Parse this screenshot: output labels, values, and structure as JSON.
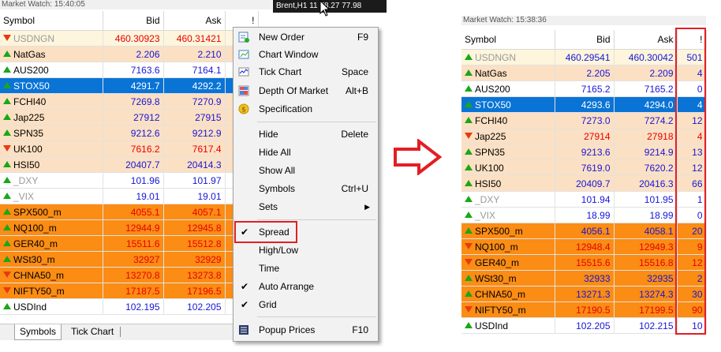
{
  "left": {
    "title": "Market Watch: 15:40:05",
    "columns": [
      "Symbol",
      "Bid",
      "Ask",
      "!"
    ],
    "rows": [
      {
        "symbol": "USDNGN",
        "bid": "460.30923",
        "ask": "460.31421",
        "bg": "yellow",
        "tc": "red",
        "dir": "down",
        "gray": true
      },
      {
        "symbol": "NatGas",
        "bid": "2.206",
        "ask": "2.210",
        "bg": "peach",
        "tc": "blue",
        "dir": "up",
        "gray": false
      },
      {
        "symbol": "AUS200",
        "bid": "7163.6",
        "ask": "7164.1",
        "bg": "white",
        "tc": "blue",
        "dir": "up",
        "gray": false
      },
      {
        "symbol": "STOX50",
        "bid": "4291.7",
        "ask": "4292.2",
        "bg": "blue",
        "tc": "blue",
        "dir": "up",
        "gray": false
      },
      {
        "symbol": "FCHI40",
        "bid": "7269.8",
        "ask": "7270.9",
        "bg": "peach",
        "tc": "blue",
        "dir": "up",
        "gray": false
      },
      {
        "symbol": "Jap225",
        "bid": "27912",
        "ask": "27915",
        "bg": "peach",
        "tc": "blue",
        "dir": "up",
        "gray": false
      },
      {
        "symbol": "SPN35",
        "bid": "9212.6",
        "ask": "9212.9",
        "bg": "peach",
        "tc": "blue",
        "dir": "up",
        "gray": false
      },
      {
        "symbol": "UK100",
        "bid": "7616.2",
        "ask": "7617.4",
        "bg": "peach",
        "tc": "red",
        "dir": "down",
        "gray": false
      },
      {
        "symbol": "HSI50",
        "bid": "20407.7",
        "ask": "20414.3",
        "bg": "peach",
        "tc": "blue",
        "dir": "up",
        "gray": false
      },
      {
        "symbol": "_DXY",
        "bid": "101.96",
        "ask": "101.97",
        "bg": "white",
        "tc": "blue",
        "dir": "up",
        "gray": true
      },
      {
        "symbol": "_VIX",
        "bid": "19.01",
        "ask": "19.01",
        "bg": "white",
        "tc": "blue",
        "dir": "up",
        "gray": true
      },
      {
        "symbol": "SPX500_m",
        "bid": "4055.1",
        "ask": "4057.1",
        "bg": "orange",
        "tc": "red",
        "dir": "up",
        "gray": false
      },
      {
        "symbol": "NQ100_m",
        "bid": "12944.9",
        "ask": "12945.8",
        "bg": "orange",
        "tc": "red",
        "dir": "up",
        "gray": false
      },
      {
        "symbol": "GER40_m",
        "bid": "15511.6",
        "ask": "15512.8",
        "bg": "orange",
        "tc": "red",
        "dir": "up",
        "gray": false
      },
      {
        "symbol": "WSt30_m",
        "bid": "32927",
        "ask": "32929",
        "bg": "orange",
        "tc": "red",
        "dir": "up",
        "gray": false
      },
      {
        "symbol": "CHNA50_m",
        "bid": "13270.8",
        "ask": "13273.8",
        "bg": "orange",
        "tc": "red",
        "dir": "down",
        "gray": false
      },
      {
        "symbol": "NIFTY50_m",
        "bid": "17187.5",
        "ask": "17196.5",
        "bg": "orange",
        "tc": "red",
        "dir": "down",
        "gray": false
      },
      {
        "symbol": "USDInd",
        "bid": "102.195",
        "ask": "102.205",
        "bg": "white",
        "tc": "blue",
        "dir": "up",
        "gray": false
      }
    ],
    "tabs": [
      "Symbols",
      "Tick Chart"
    ]
  },
  "chart_window_title": "Brent,H1  11 78.27 77.98",
  "menu": {
    "items": [
      {
        "label": "New Order",
        "shortcut": "F9",
        "icon": "new-order-icon"
      },
      {
        "label": "Chart Window",
        "shortcut": "",
        "icon": "chart-window-icon"
      },
      {
        "label": "Tick Chart",
        "shortcut": "Space",
        "icon": "tick-chart-icon"
      },
      {
        "label": "Depth Of Market",
        "shortcut": "Alt+B",
        "icon": "depth-of-market-icon"
      },
      {
        "label": "Specification",
        "shortcut": "",
        "icon": "specification-icon"
      },
      {
        "label": "Hide",
        "shortcut": "Delete",
        "icon": ""
      },
      {
        "label": "Hide All",
        "shortcut": "",
        "icon": ""
      },
      {
        "label": "Show All",
        "shortcut": "",
        "icon": ""
      },
      {
        "label": "Symbols",
        "shortcut": "Ctrl+U",
        "icon": ""
      },
      {
        "label": "Sets",
        "shortcut": "",
        "icon": "submenu-arrow-icon"
      },
      {
        "label": "Spread",
        "shortcut": "",
        "icon": "checkmark-icon"
      },
      {
        "label": "High/Low",
        "shortcut": "",
        "icon": ""
      },
      {
        "label": "Time",
        "shortcut": "",
        "icon": ""
      },
      {
        "label": "Auto Arrange",
        "shortcut": "",
        "icon": "checkmark-icon"
      },
      {
        "label": "Grid",
        "shortcut": "",
        "icon": "checkmark-icon"
      },
      {
        "label": "Popup Prices",
        "shortcut": "F10",
        "icon": "popup-prices-icon"
      }
    ]
  },
  "right": {
    "title": "Market Watch: 15:38:36",
    "columns": [
      "Symbol",
      "Bid",
      "Ask",
      "!"
    ],
    "rows": [
      {
        "symbol": "USDNGN",
        "bid": "460.29541",
        "ask": "460.30042",
        "spread": "501",
        "bg": "yellow",
        "tc": "blue",
        "dir": "up",
        "gray": true
      },
      {
        "symbol": "NatGas",
        "bid": "2.205",
        "ask": "2.209",
        "spread": "4",
        "bg": "peach",
        "tc": "blue",
        "dir": "up",
        "gray": false
      },
      {
        "symbol": "AUS200",
        "bid": "7165.2",
        "ask": "7165.2",
        "spread": "0",
        "bg": "white",
        "tc": "blue",
        "dir": "up",
        "gray": false
      },
      {
        "symbol": "STOX50",
        "bid": "4293.6",
        "ask": "4294.0",
        "spread": "4",
        "bg": "blue",
        "tc": "blue",
        "dir": "up",
        "gray": false
      },
      {
        "symbol": "FCHI40",
        "bid": "7273.0",
        "ask": "7274.2",
        "spread": "12",
        "bg": "peach",
        "tc": "blue",
        "dir": "up",
        "gray": false
      },
      {
        "symbol": "Jap225",
        "bid": "27914",
        "ask": "27918",
        "spread": "4",
        "bg": "peach",
        "tc": "red",
        "dir": "down",
        "gray": false
      },
      {
        "symbol": "SPN35",
        "bid": "9213.6",
        "ask": "9214.9",
        "spread": "13",
        "bg": "peach",
        "tc": "blue",
        "dir": "up",
        "gray": false
      },
      {
        "symbol": "UK100",
        "bid": "7619.0",
        "ask": "7620.2",
        "spread": "12",
        "bg": "peach",
        "tc": "blue",
        "dir": "up",
        "gray": false
      },
      {
        "symbol": "HSI50",
        "bid": "20409.7",
        "ask": "20416.3",
        "spread": "66",
        "bg": "peach",
        "tc": "blue",
        "dir": "up",
        "gray": false
      },
      {
        "symbol": "_DXY",
        "bid": "101.94",
        "ask": "101.95",
        "spread": "1",
        "bg": "white",
        "tc": "blue",
        "dir": "up",
        "gray": true
      },
      {
        "symbol": "_VIX",
        "bid": "18.99",
        "ask": "18.99",
        "spread": "0",
        "bg": "white",
        "tc": "blue",
        "dir": "up",
        "gray": true
      },
      {
        "symbol": "SPX500_m",
        "bid": "4056.1",
        "ask": "4058.1",
        "spread": "20",
        "bg": "orange",
        "tc": "blue",
        "dir": "up",
        "gray": false
      },
      {
        "symbol": "NQ100_m",
        "bid": "12948.4",
        "ask": "12949.3",
        "spread": "9",
        "bg": "orange",
        "tc": "red",
        "dir": "down",
        "gray": false
      },
      {
        "symbol": "GER40_m",
        "bid": "15515.6",
        "ask": "15516.8",
        "spread": "12",
        "bg": "orange",
        "tc": "red",
        "dir": "down",
        "gray": false
      },
      {
        "symbol": "WSt30_m",
        "bid": "32933",
        "ask": "32935",
        "spread": "2",
        "bg": "orange",
        "tc": "blue",
        "dir": "up",
        "gray": false
      },
      {
        "symbol": "CHNA50_m",
        "bid": "13271.3",
        "ask": "13274.3",
        "spread": "30",
        "bg": "orange",
        "tc": "blue",
        "dir": "up",
        "gray": false
      },
      {
        "symbol": "NIFTY50_m",
        "bid": "17190.5",
        "ask": "17199.5",
        "spread": "90",
        "bg": "orange",
        "tc": "red",
        "dir": "down",
        "gray": false
      },
      {
        "symbol": "USDInd",
        "bid": "102.205",
        "ask": "102.215",
        "spread": "10",
        "bg": "white",
        "tc": "blue",
        "dir": "up",
        "gray": false
      }
    ]
  },
  "colors": {
    "highlight_red": "#e31e24",
    "selected_blue": "#0a74d6",
    "orange_row": "#fb8c14",
    "peach_row": "#fce0c3",
    "up_green": "#18a818",
    "down_red": "#e83a12"
  }
}
